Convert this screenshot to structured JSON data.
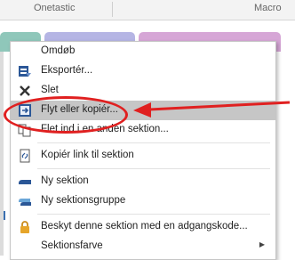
{
  "ribbon": {
    "left_label": "Onetastic",
    "right_label": "Macro"
  },
  "menu": {
    "items": [
      {
        "label": "Omdøb",
        "icon": "none",
        "access_key": "O"
      },
      {
        "label": "Eksportér...",
        "icon": "export-icon",
        "access_key": "E"
      },
      {
        "label": "Slet",
        "icon": "delete-x-icon",
        "access_key": "S"
      },
      {
        "label": "Flyt eller kopiér...",
        "icon": "move-copy-icon",
        "access_key": "F",
        "highlighted": true
      },
      {
        "label": "Flet ind i en anden sektion...",
        "icon": "merge-icon"
      },
      {
        "label": "Kopiér link til sektion",
        "icon": "copy-link-icon"
      },
      {
        "label": "Ny sektion",
        "icon": "new-section-icon"
      },
      {
        "label": "Ny sektionsgruppe",
        "icon": "new-section-group-icon"
      },
      {
        "label": "Beskyt denne sektion med en adgangskode...",
        "icon": "lock-icon"
      },
      {
        "label": "Sektionsfarve",
        "icon": "none",
        "has_submenu": true
      }
    ]
  },
  "annotation": {
    "color": "#e02020"
  },
  "colors": {
    "tab_teal": "#8fc7ba",
    "tab_lavender": "#b5b5e4",
    "tab_pink": "#d6a6d6",
    "highlight": "#c6c6c6"
  }
}
